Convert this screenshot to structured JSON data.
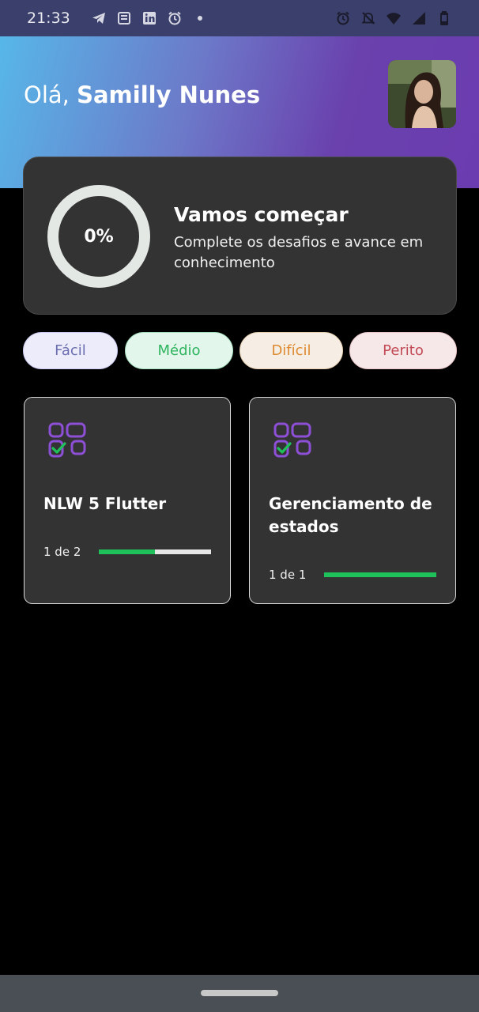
{
  "status_bar": {
    "time": "21:33",
    "left_icons": [
      "telegram-icon",
      "news-icon",
      "linkedin-icon",
      "alarm-icon",
      "dot-icon"
    ],
    "right_icons": [
      "alarm-icon",
      "bell-off-icon",
      "wifi-icon",
      "signal-icon",
      "battery-icon"
    ]
  },
  "header": {
    "greeting": "Olá,",
    "user_name": "Samilly Nunes",
    "avatar": "user-avatar"
  },
  "progress_card": {
    "percent_label": "0%",
    "percent_value": 0,
    "title": "Vamos começar",
    "subtitle": "Complete os desafios e avance em conhecimento"
  },
  "levels": [
    {
      "label": "Fácil",
      "color": "#6b6fb0"
    },
    {
      "label": "Médio",
      "color": "#2fb45e"
    },
    {
      "label": "Difícil",
      "color": "#dd8a30"
    },
    {
      "label": "Perito",
      "color": "#c24a55"
    }
  ],
  "quizzes": [
    {
      "title": "NLW 5 Flutter",
      "progress_text": "1 de 2",
      "progress": 0.5,
      "icon": "quiz-checklist-icon"
    },
    {
      "title": "Gerenciamento de estados",
      "progress_text": "1 de 1",
      "progress": 1.0,
      "icon": "quiz-checklist-icon"
    }
  ],
  "colors": {
    "accent_purple": "#8d4fd6",
    "progress_green": "#1fc25a",
    "card_bg": "#333333"
  }
}
